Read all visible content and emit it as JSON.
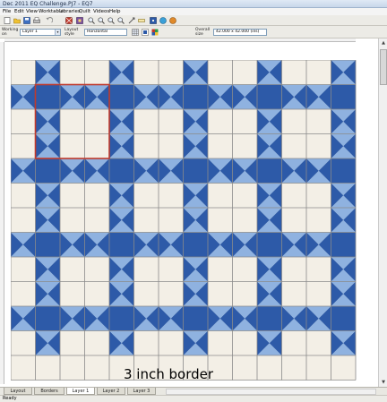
{
  "window": {
    "title": "Dec 2011 EQ Challenge.PJ7 - EQ7"
  },
  "menu": [
    "File",
    "Edit",
    "View",
    "Worktable",
    "Libraries",
    "Quilt",
    "Videos",
    "Help"
  ],
  "toolbar": {
    "buttons": [
      {
        "name": "new-icon"
      },
      {
        "name": "open-icon"
      },
      {
        "name": "save-icon"
      },
      {
        "name": "print-icon"
      },
      {
        "name": "undo-icon"
      },
      {
        "name": "quilt-worktable-icon"
      },
      {
        "name": "block-worktable-icon"
      },
      {
        "name": "zoom-in-icon"
      },
      {
        "name": "zoom-out-icon"
      },
      {
        "name": "zoom-fit-icon"
      },
      {
        "name": "zoom-refresh-icon"
      },
      {
        "name": "pan-icon"
      },
      {
        "name": "measure-icon"
      },
      {
        "name": "fabric-icon"
      },
      {
        "name": "help-icon"
      },
      {
        "name": "info-icon"
      }
    ]
  },
  "properties": {
    "working_on_label": "Working on",
    "layer_value": "Layer 1",
    "layout_style_label": "Layout style",
    "layout_style_value": "Horizontal",
    "overall_size_label": "Overall size",
    "overall_size_value": "42.000 x 42.000 (ins)"
  },
  "caption": "3 inch border",
  "tabs": [
    {
      "label": "Layout",
      "active": false
    },
    {
      "label": "Borders",
      "active": false
    },
    {
      "label": "Layer 1",
      "active": true
    },
    {
      "label": "Layer 2",
      "active": false
    },
    {
      "label": "Layer 3",
      "active": false
    }
  ],
  "status": "Ready",
  "colors": {
    "background_fabric": "#f3efe6",
    "dark_blue": "#2d5aa8",
    "light_blue": "#8fb2e0",
    "grid_line": "#8a8a8a",
    "highlight": "#c0392b"
  },
  "quilt": {
    "columns": 14,
    "rows": 13,
    "block_size_inches": 3
  }
}
